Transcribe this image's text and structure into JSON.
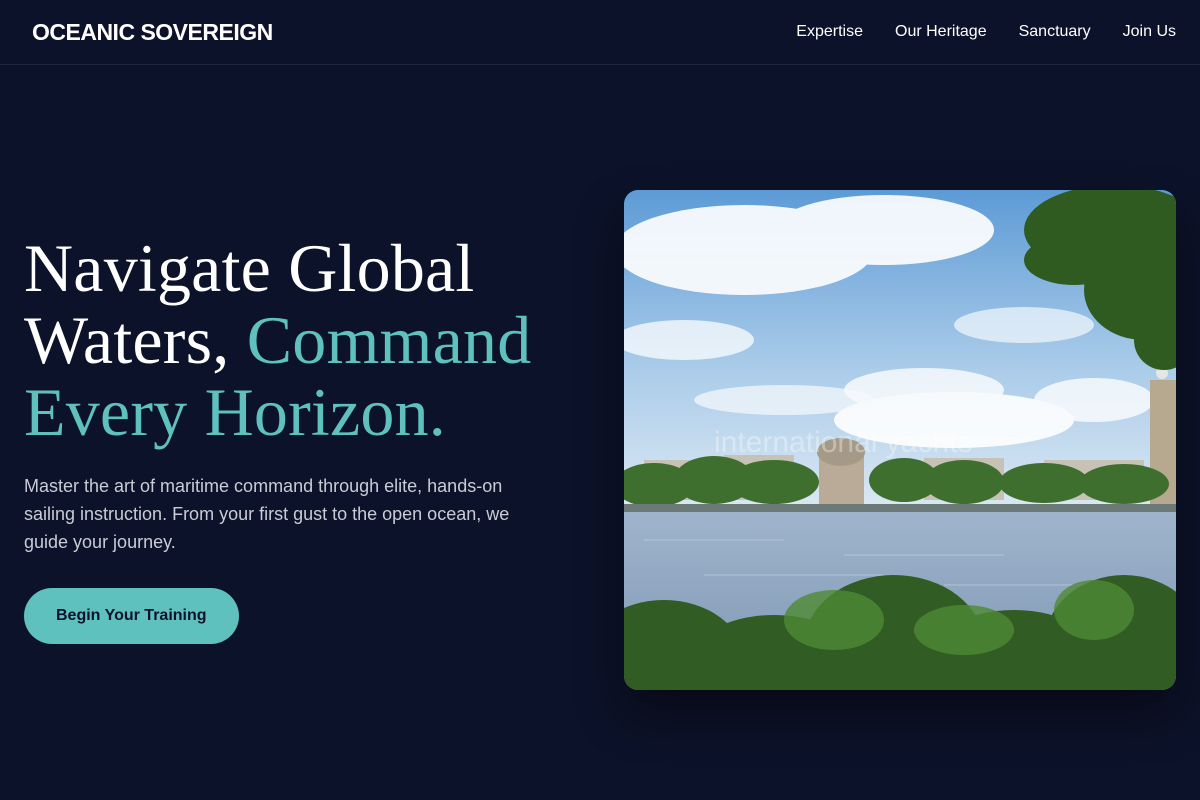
{
  "header": {
    "brand": "OCEANIC SOVEREIGN",
    "nav": [
      "Expertise",
      "Our Heritage",
      "Sanctuary",
      "Join Us"
    ]
  },
  "hero": {
    "title_line1": "Navigate Global",
    "title_line2_plain": "Waters, ",
    "title_line2_accent": "Command",
    "title_line3_accent": "Every Horizon.",
    "lead": "Master the art of maritime command through elite, hands-on sailing instruction. From your first gust to the open ocean, we guide your journey.",
    "cta": "Begin Your Training"
  },
  "image": {
    "overlay_text": "international yachts",
    "subject": "river-with-domed-building-and-trees"
  },
  "colors": {
    "background": "#0c1229",
    "accent": "#5fc1bd",
    "text": "#ffffff",
    "muted": "#c9ccd6"
  }
}
